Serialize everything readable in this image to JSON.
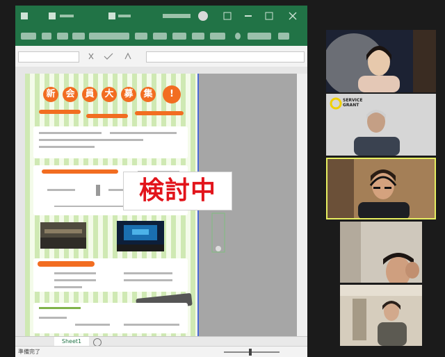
{
  "shared_screen": {
    "app": "spreadsheet",
    "theme_color": "#217346",
    "stamp_text": "検討中",
    "stamp_color": "#e2141b",
    "sheet_tab": "Sheet1",
    "status": "準備完了"
  },
  "flyer": {
    "headline_chars": [
      "新",
      "会",
      "員",
      "大",
      "募",
      "集",
      "!"
    ]
  },
  "participants": [
    {
      "id": "participant-1",
      "speaking": false
    },
    {
      "id": "participant-2",
      "speaking": false,
      "logo_line1": "SERVICE",
      "logo_line2": "GRANT"
    },
    {
      "id": "participant-3",
      "speaking": true
    },
    {
      "id": "participant-4",
      "speaking": false
    },
    {
      "id": "participant-5",
      "speaking": false
    }
  ],
  "colors": {
    "accent": "#f26d21",
    "speaking_border": "#e7f061",
    "page_border": "#4a6bd6"
  }
}
